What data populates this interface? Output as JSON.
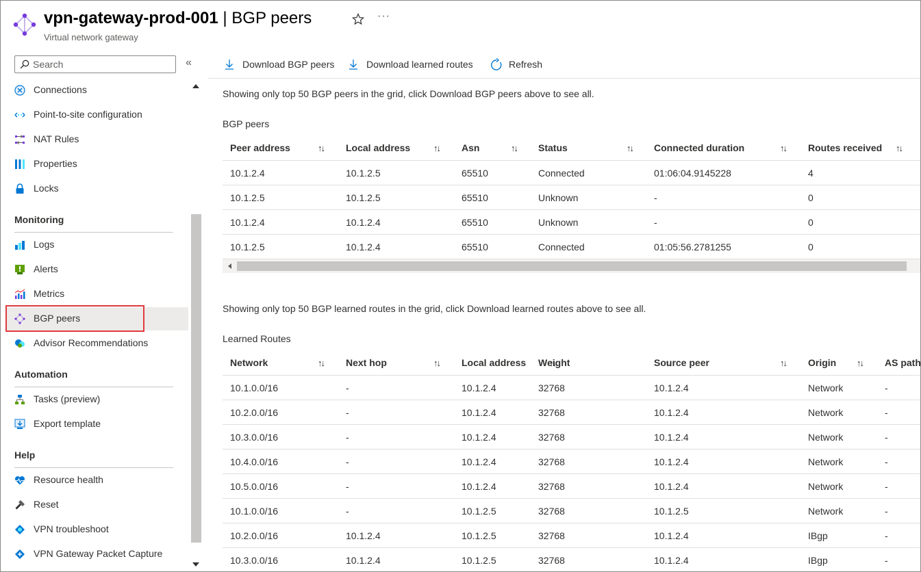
{
  "header": {
    "resource_name": "vpn-gateway-prod-001",
    "separator": " | ",
    "blade_title": "BGP peers",
    "subtitle": "Virtual network gateway",
    "more": "···"
  },
  "sidebar": {
    "search_placeholder": "Search",
    "collapse": "«",
    "items_top": [
      {
        "label": "Connections",
        "icon": "connections-icon"
      },
      {
        "label": "Point-to-site configuration",
        "icon": "point-to-site-icon"
      },
      {
        "label": "NAT Rules",
        "icon": "nat-rules-icon"
      },
      {
        "label": "Properties",
        "icon": "properties-icon"
      },
      {
        "label": "Locks",
        "icon": "lock-icon"
      }
    ],
    "sections": {
      "monitoring": "Monitoring",
      "automation": "Automation",
      "help": "Help"
    },
    "monitoring_items": [
      {
        "label": "Logs",
        "icon": "logs-icon"
      },
      {
        "label": "Alerts",
        "icon": "alerts-icon"
      },
      {
        "label": "Metrics",
        "icon": "metrics-icon"
      },
      {
        "label": "BGP peers",
        "icon": "bgp-peers-icon",
        "selected": true
      },
      {
        "label": "Advisor Recommendations",
        "icon": "advisor-icon"
      }
    ],
    "automation_items": [
      {
        "label": "Tasks (preview)",
        "icon": "tasks-icon"
      },
      {
        "label": "Export template",
        "icon": "export-template-icon"
      }
    ],
    "help_items": [
      {
        "label": "Resource health",
        "icon": "resource-health-icon"
      },
      {
        "label": "Reset",
        "icon": "reset-icon"
      },
      {
        "label": "VPN troubleshoot",
        "icon": "vpn-troubleshoot-icon"
      },
      {
        "label": "VPN Gateway Packet Capture",
        "icon": "packet-capture-icon"
      }
    ]
  },
  "toolbar": {
    "download_peers": "Download BGP peers",
    "download_routes": "Download learned routes",
    "refresh": "Refresh"
  },
  "peers": {
    "note": "Showing only top 50 BGP peers in the grid, click Download BGP peers above to see all.",
    "title": "BGP peers",
    "columns": [
      "Peer address",
      "Local address",
      "Asn",
      "Status",
      "Connected duration",
      "Routes received"
    ],
    "sort_glyph": "↑↓",
    "rows": [
      [
        "10.1.2.4",
        "10.1.2.5",
        "65510",
        "Connected",
        "01:06:04.9145228",
        "4"
      ],
      [
        "10.1.2.5",
        "10.1.2.5",
        "65510",
        "Unknown",
        "-",
        "0"
      ],
      [
        "10.1.2.4",
        "10.1.2.4",
        "65510",
        "Unknown",
        "-",
        "0"
      ],
      [
        "10.1.2.5",
        "10.1.2.4",
        "65510",
        "Connected",
        "01:05:56.2781255",
        "0"
      ]
    ]
  },
  "routes": {
    "note": "Showing only top 50 BGP learned routes in the grid, click Download learned routes above to see all.",
    "title": "Learned Routes",
    "columns": [
      "Network",
      "Next hop",
      "Local address",
      "Weight",
      "Source peer",
      "Origin",
      "AS path"
    ],
    "rows": [
      [
        "10.1.0.0/16",
        "-",
        "10.1.2.4",
        "32768",
        "10.1.2.4",
        "Network",
        "-"
      ],
      [
        "10.2.0.0/16",
        "-",
        "10.1.2.4",
        "32768",
        "10.1.2.4",
        "Network",
        "-"
      ],
      [
        "10.3.0.0/16",
        "-",
        "10.1.2.4",
        "32768",
        "10.1.2.4",
        "Network",
        "-"
      ],
      [
        "10.4.0.0/16",
        "-",
        "10.1.2.4",
        "32768",
        "10.1.2.4",
        "Network",
        "-"
      ],
      [
        "10.5.0.0/16",
        "-",
        "10.1.2.4",
        "32768",
        "10.1.2.4",
        "Network",
        "-"
      ],
      [
        "10.1.0.0/16",
        "-",
        "10.1.2.5",
        "32768",
        "10.1.2.5",
        "Network",
        "-"
      ],
      [
        "10.2.0.0/16",
        "10.1.2.4",
        "10.1.2.5",
        "32768",
        "10.1.2.4",
        "IBgp",
        "-"
      ],
      [
        "10.3.0.0/16",
        "10.1.2.4",
        "10.1.2.5",
        "32768",
        "10.1.2.4",
        "IBgp",
        "-"
      ]
    ]
  },
  "colors": {
    "accent": "#0078d4",
    "selection_outline": "#e0393e",
    "selected_bg": "#edebe9"
  }
}
